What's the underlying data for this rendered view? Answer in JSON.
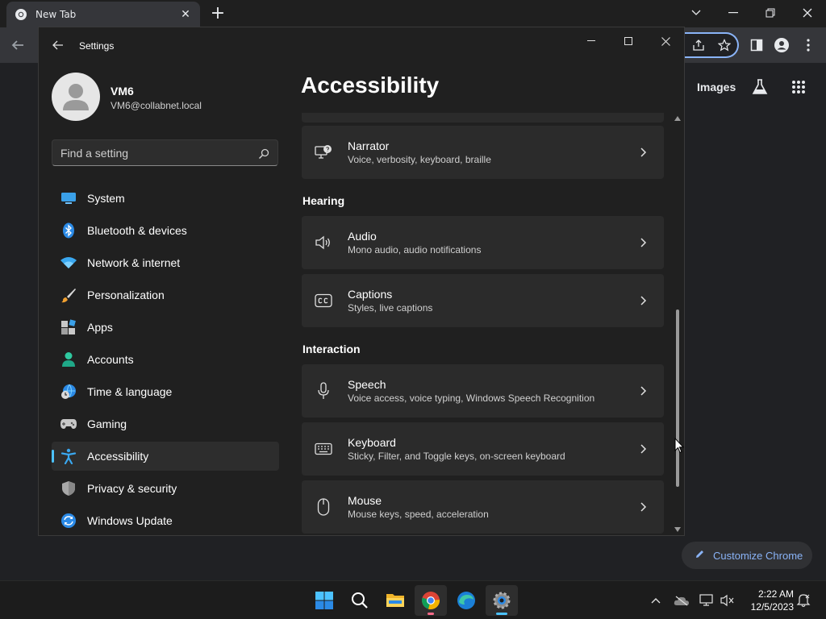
{
  "chrome": {
    "tab_title": "New Tab",
    "images_link": "Images",
    "customize_label": "Customize Chrome"
  },
  "settings": {
    "window_title": "Settings",
    "user": {
      "name": "VM6",
      "email": "VM6@collabnet.local"
    },
    "search": {
      "placeholder": "Find a setting"
    },
    "nav": [
      {
        "label": "System",
        "icon": "monitor-icon"
      },
      {
        "label": "Bluetooth & devices",
        "icon": "bluetooth-icon"
      },
      {
        "label": "Network & internet",
        "icon": "wifi-icon"
      },
      {
        "label": "Personalization",
        "icon": "brush-icon"
      },
      {
        "label": "Apps",
        "icon": "apps-icon"
      },
      {
        "label": "Accounts",
        "icon": "person-icon"
      },
      {
        "label": "Time & language",
        "icon": "globe-clock-icon"
      },
      {
        "label": "Gaming",
        "icon": "gamepad-icon"
      },
      {
        "label": "Accessibility",
        "icon": "accessibility-icon",
        "active": true
      },
      {
        "label": "Privacy & security",
        "icon": "shield-icon"
      },
      {
        "label": "Windows Update",
        "icon": "update-icon"
      }
    ],
    "page_title": "Accessibility",
    "sections": {
      "hearing": "Hearing",
      "interaction": "Interaction"
    },
    "cards": [
      {
        "title": "Narrator",
        "subtitle": "Voice, verbosity, keyboard, braille",
        "icon": "narrator-icon"
      },
      {
        "title": "Audio",
        "subtitle": "Mono audio, audio notifications",
        "icon": "speaker-icon"
      },
      {
        "title": "Captions",
        "subtitle": "Styles, live captions",
        "icon": "captions-icon"
      },
      {
        "title": "Speech",
        "subtitle": "Voice access, voice typing, Windows Speech Recognition",
        "icon": "microphone-icon"
      },
      {
        "title": "Keyboard",
        "subtitle": "Sticky, Filter, and Toggle keys, on-screen keyboard",
        "icon": "keyboard-icon"
      },
      {
        "title": "Mouse",
        "subtitle": "Mouse keys, speed, acceleration",
        "icon": "mouse-icon"
      }
    ]
  },
  "taskbar": {
    "time": "2:22 AM",
    "date": "12/5/2023"
  },
  "colors": {
    "accent": "#4cc2ff",
    "chrome_link": "#8ab4f8"
  }
}
